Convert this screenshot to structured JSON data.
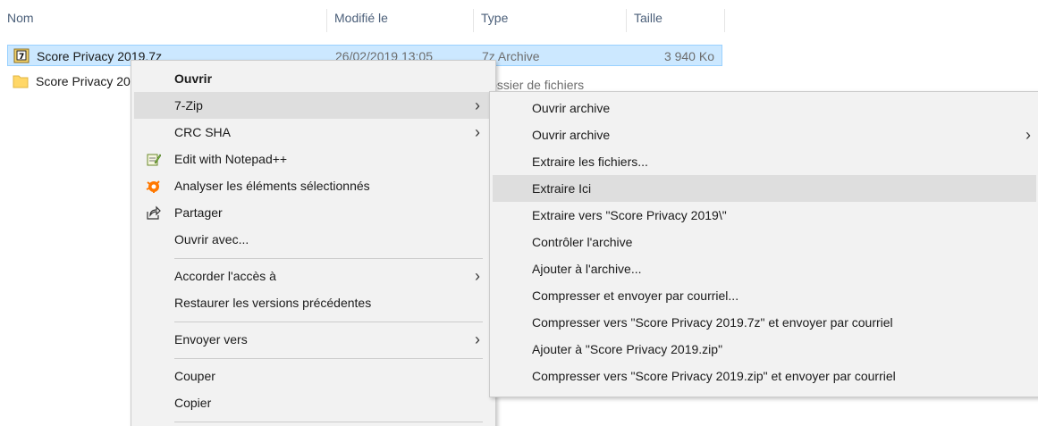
{
  "columns": {
    "name": "Nom",
    "modified": "Modifié le",
    "type": "Type",
    "size": "Taille"
  },
  "files": [
    {
      "name": "Score Privacy 2019.7z",
      "modified": "26/02/2019 13:05",
      "type": "7z Archive",
      "size": "3 940 Ko",
      "icon": "7z-archive-icon",
      "selected": true
    },
    {
      "name": "Score Privacy 2019",
      "modified": "",
      "type": "Dossier de fichiers",
      "size": "",
      "icon": "folder-icon",
      "selected": false
    }
  ],
  "context_menu": {
    "open": "Ouvrir",
    "seven_zip": "7-Zip",
    "crc_sha": "CRC SHA",
    "edit_notepad": "Edit with Notepad++",
    "analyse": "Analyser les éléments sélectionnés",
    "share": "Partager",
    "open_with": "Ouvrir avec...",
    "grant_access": "Accorder l'accès à",
    "restore_versions": "Restaurer les versions précédentes",
    "send_to": "Envoyer vers",
    "cut": "Couper",
    "copy": "Copier"
  },
  "submenu_7zip": {
    "items": [
      "Ouvrir archive",
      "Ouvrir archive",
      "Extraire les fichiers...",
      "Extraire Ici",
      "Extraire vers \"Score Privacy 2019\\\"",
      "Contrôler l'archive",
      "Ajouter à l'archive...",
      "Compresser et envoyer par courriel...",
      "Compresser vers \"Score Privacy 2019.7z\" et envoyer par courriel",
      "Ajouter à \"Score Privacy 2019.zip\"",
      "Compresser vers \"Score Privacy 2019.zip\" et envoyer par courriel"
    ],
    "hovered_index": 3
  },
  "colors": {
    "selection_bg": "#cce8ff",
    "menu_bg": "#f2f2f2",
    "menu_hover": "#dedede",
    "header_text": "#4c607a",
    "avast_orange": "#ff7800"
  }
}
